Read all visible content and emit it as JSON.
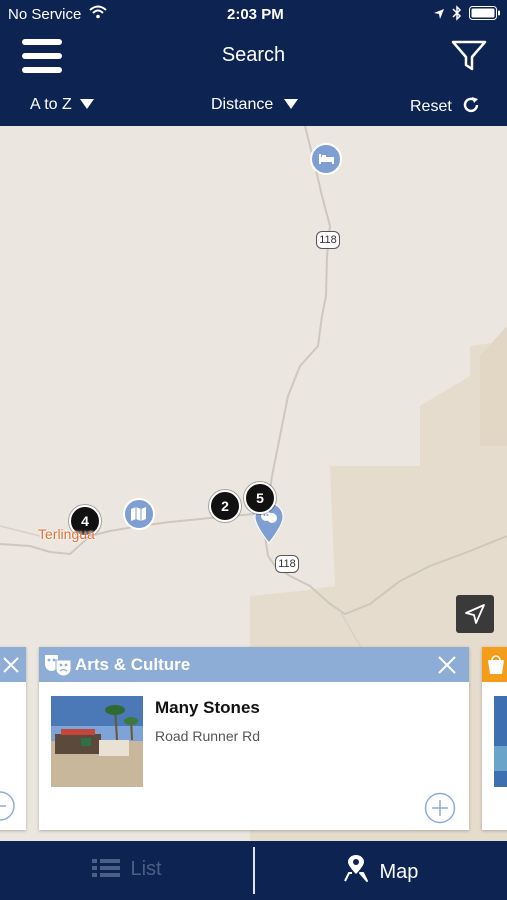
{
  "status": {
    "carrier": "No Service",
    "time": "2:03 PM"
  },
  "nav": {
    "title": "Search"
  },
  "sort": {
    "atoz": "A to Z",
    "distance": "Distance",
    "reset": "Reset"
  },
  "map": {
    "place_label": "Terlingua",
    "route_a": "118",
    "route_b": "118",
    "clusters": [
      "4",
      "2",
      "5"
    ]
  },
  "card": {
    "category": "Arts & Culture",
    "title": "Many Stones",
    "address": "Road Runner Rd"
  },
  "tabs": {
    "list": "List",
    "map": "Map"
  },
  "colors": {
    "navy": "#0d2352",
    "card_header": "#8dadd7",
    "accent_orange": "#f59c1a"
  }
}
